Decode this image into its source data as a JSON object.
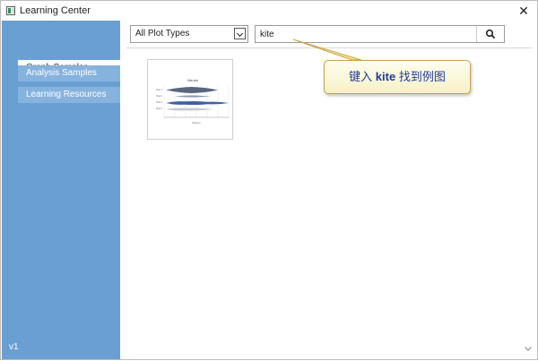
{
  "window": {
    "title": "Learning Center",
    "version": "v1"
  },
  "sidebar": {
    "items": [
      {
        "label": "Graph Samples",
        "active": true
      },
      {
        "label": "Analysis Samples",
        "active": false
      },
      {
        "label": "Learning Resources",
        "active": false
      }
    ]
  },
  "toolbar": {
    "plot_type_selected": "All Plot Types",
    "search_value": "kite"
  },
  "callout": {
    "prefix": "键入 ",
    "keyword": "kite",
    "suffix": " 找到例图"
  },
  "thumbnail": {
    "title": "Kite plot",
    "xlabel": "Distance",
    "rows": [
      "Row 1",
      "Row 2",
      "Row 3",
      "Row 4"
    ]
  },
  "icons": {
    "app": "app-icon",
    "close": "close-icon",
    "dropdown": "chevron-down-icon",
    "search": "search-icon",
    "scroll": "chevron-down-icon"
  },
  "colors": {
    "sidebar": "#6a9fd3",
    "active_item": "#ffffff",
    "inactive_item": "#86b2de",
    "callout_text": "#1f3c99",
    "callout_border": "#c9a24d"
  }
}
